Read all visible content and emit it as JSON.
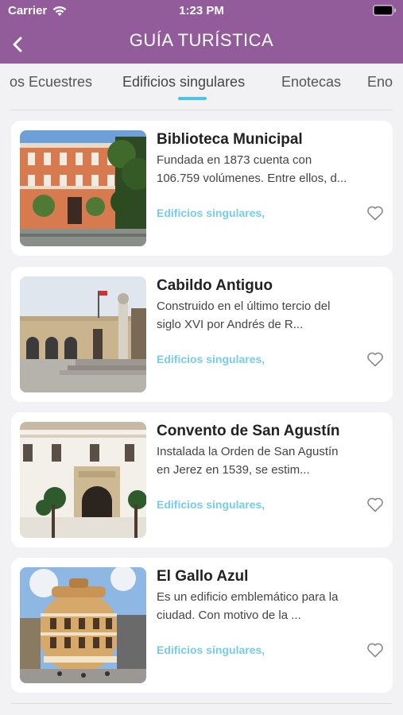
{
  "status_bar": {
    "carrier": "Carrier",
    "time": "1:23 PM"
  },
  "header": {
    "title": "GUÍA TURÍSTICA"
  },
  "tabs": [
    {
      "label": "os Ecuestres"
    },
    {
      "label": "Edificios singulares",
      "active": true
    },
    {
      "label": "Enotecas"
    },
    {
      "label": "Eno"
    }
  ],
  "colors": {
    "header": "#925c9b",
    "accent": "#4ec3e6",
    "category": "#76cdea"
  },
  "places": [
    {
      "title": "Biblioteca Municipal",
      "desc1": "Fundada en 1873 cuenta con",
      "desc2": "106.759 volúmenes. Entre ellos, d...",
      "category": "Edificios singulares,",
      "image": "orange-facade-photo"
    },
    {
      "title": "Cabildo Antiguo",
      "desc1": "Construido en el último tercio del",
      "desc2": "siglo XVI por Andrés de R...",
      "category": "Edificios singulares,",
      "image": "plaza-monument-photo"
    },
    {
      "title": "Convento de San Agustín",
      "desc1": "Instalada la Orden de San Agustín",
      "desc2": "en Jerez en 1539, se estim...",
      "category": "Edificios singulares,",
      "image": "white-facade-photo"
    },
    {
      "title": "El Gallo Azul",
      "desc1": "Es un edificio emblemático para la",
      "desc2": "ciudad. Con motivo de la ...",
      "category": "Edificios singulares,",
      "image": "round-building-photo"
    }
  ]
}
